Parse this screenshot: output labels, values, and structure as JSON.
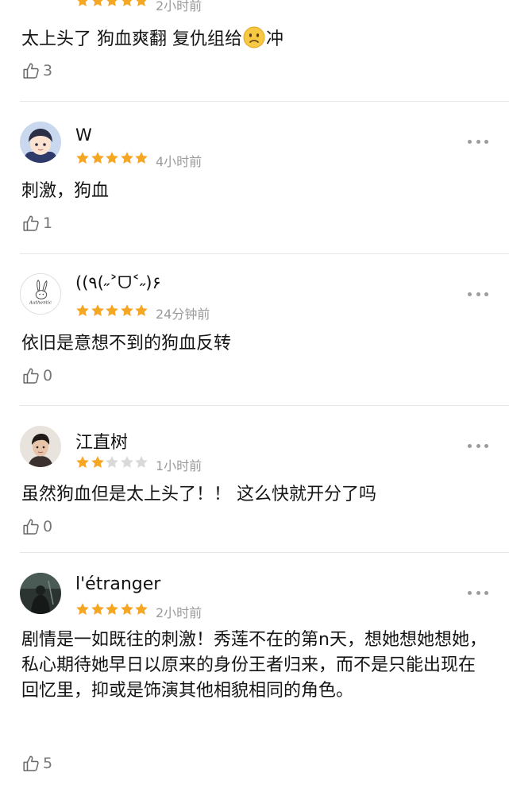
{
  "colors": {
    "star_on": "#f5a623",
    "star_off": "#d9d9d9",
    "muted": "#9a9a9a"
  },
  "reviews": [
    {
      "partial": true,
      "name": "",
      "rating": 5,
      "time": "2小时前",
      "text_before": "太上头了 狗血爽翻 复仇组给",
      "emoji": "worried-face-emoji",
      "text_after": "冲",
      "likes": "3"
    },
    {
      "name": "W",
      "avatar": "cartoon-boy-avatar",
      "rating": 5,
      "time": "4小时前",
      "text": "刺激，狗血",
      "likes": "1"
    },
    {
      "name": "((٩(˶˃ᗜ˂˶)۶",
      "avatar": "bunny-sketch-avatar",
      "avatar_text": "Authentic",
      "rating": 5,
      "time": "24分钟前",
      "text": "依旧是意想不到的狗血反转",
      "likes": "0"
    },
    {
      "name": "江直树",
      "avatar": "man-portrait-avatar",
      "rating": 2,
      "time": "1小时前",
      "text": "虽然狗血但是太上头了！！ 这么快就开分了吗",
      "likes": "0"
    },
    {
      "name": "l'étranger",
      "avatar": "dark-photo-avatar",
      "rating": 5,
      "time": "2小时前",
      "text": "剧情是一如既往的刺激！秀莲不在的第n天，想她想她想她，私心期待她早日以原来的身份王者归来，而不是只能出现在回忆里，抑或是饰演其他相貌相同的角色。",
      "likes": "5"
    }
  ]
}
